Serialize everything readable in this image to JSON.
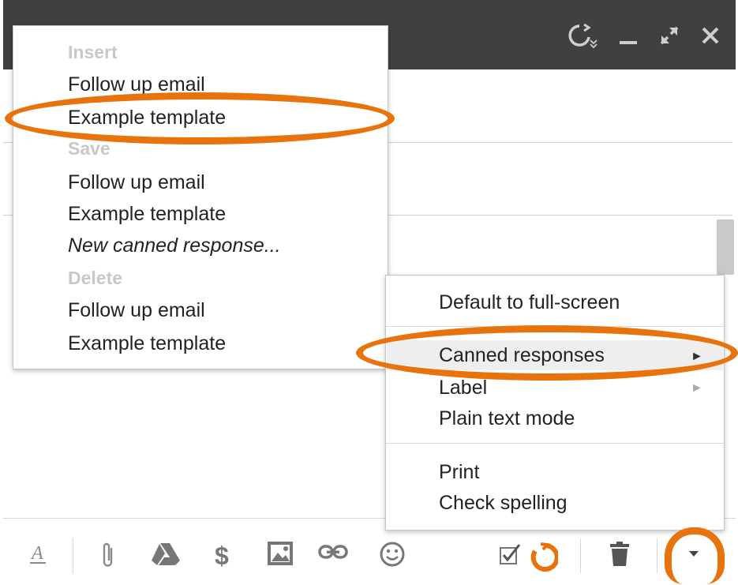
{
  "window": {
    "accent_orange": "#e8730c",
    "titlebar_color": "#404040",
    "titlebar_icons": [
      "refresh-options-icon",
      "minimize-icon",
      "expand-icon",
      "close-icon"
    ]
  },
  "canned_menu": {
    "insert": {
      "heading": "Insert",
      "items": [
        "Follow up email",
        "Example template"
      ]
    },
    "save": {
      "heading": "Save",
      "items": [
        "Follow up email",
        "Example template",
        "New canned response..."
      ]
    },
    "delete": {
      "heading": "Delete",
      "items": [
        "Follow up email",
        "Example template"
      ]
    },
    "highlighted_item": "Example template"
  },
  "more_options_menu": {
    "items": [
      {
        "label": "Default to full-screen"
      },
      {
        "label": "Canned responses",
        "submenu": true,
        "highlighted": true
      },
      {
        "label": "Label",
        "submenu": true
      },
      {
        "label": "Plain text mode"
      },
      {
        "label": "Print"
      },
      {
        "label": "Check spelling"
      }
    ],
    "arrow_glyph": "►"
  },
  "toolbar": {
    "icons": [
      "formatting-icon",
      "attach-icon",
      "drive-icon",
      "money-icon",
      "photo-icon",
      "link-icon",
      "emoji-icon",
      "checkbox-icon",
      "streak-icon",
      "trash-icon",
      "more-options-icon"
    ]
  }
}
